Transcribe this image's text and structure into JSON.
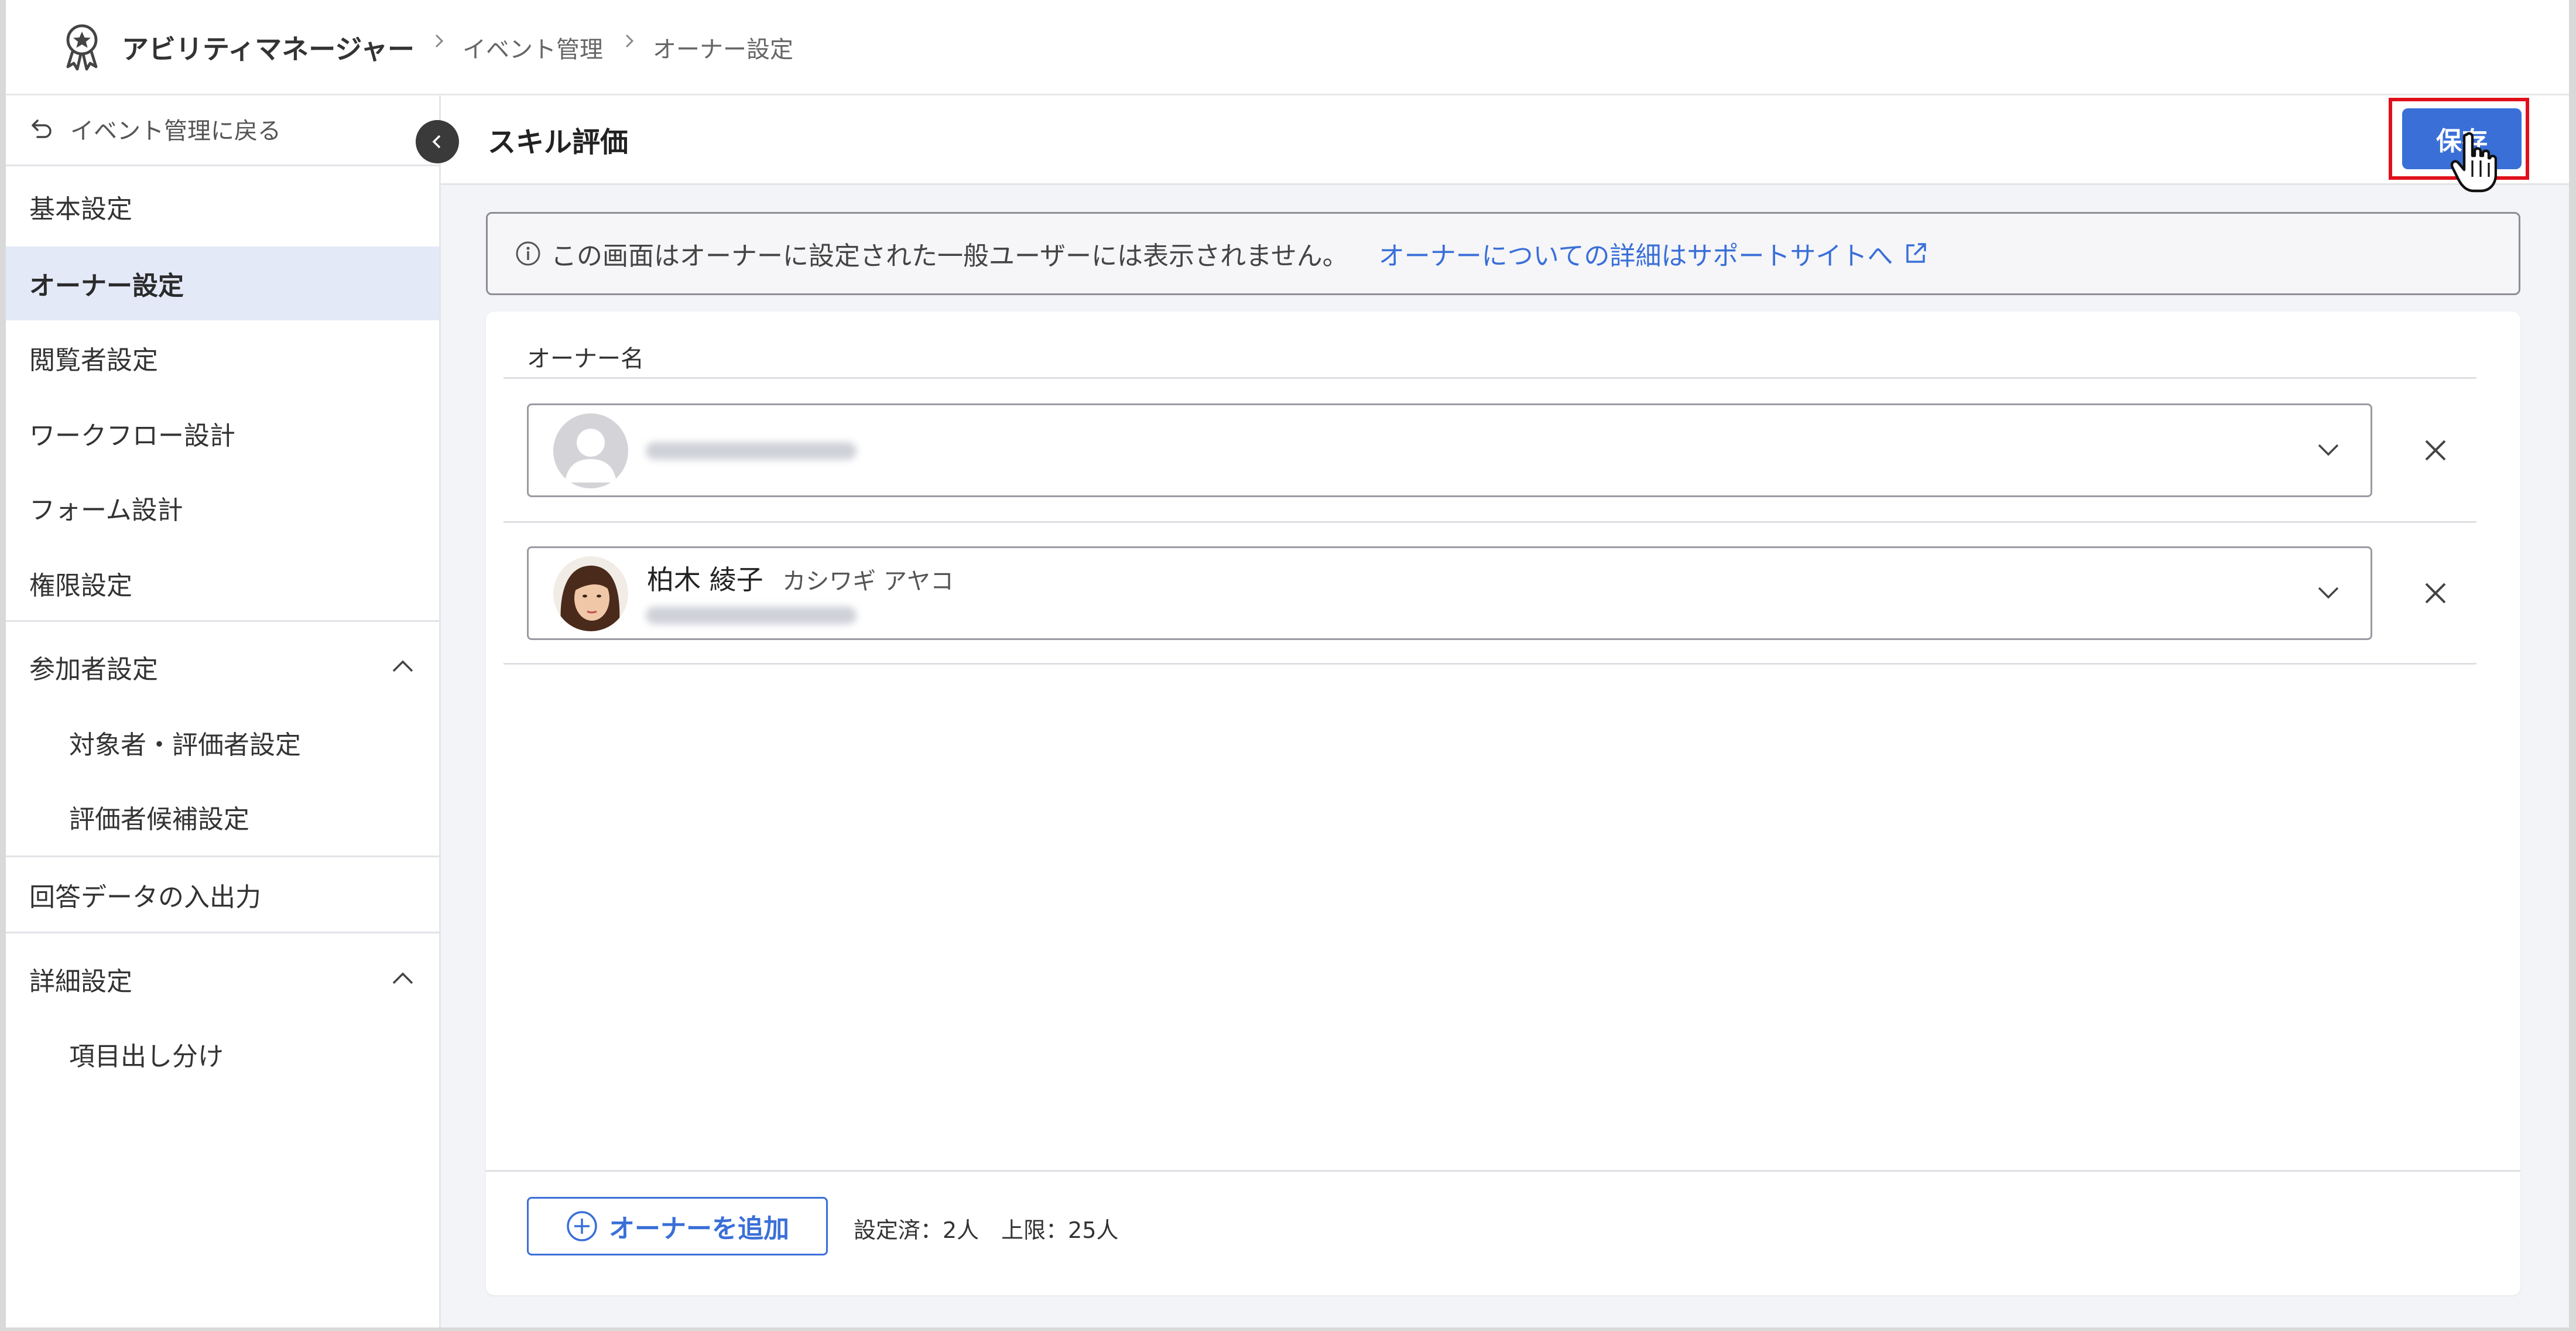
{
  "header": {
    "app_title": "アビリティマネージャー",
    "breadcrumb": [
      "イベント管理",
      "オーナー設定"
    ]
  },
  "sidebar": {
    "back_label": "イベント管理に戻る",
    "items": [
      {
        "label": "基本設定"
      },
      {
        "label": "オーナー設定",
        "active": true
      },
      {
        "label": "閲覧者設定"
      },
      {
        "label": "ワークフロー設計"
      },
      {
        "label": "フォーム設計"
      },
      {
        "label": "権限設定"
      },
      {
        "label": "参加者設定",
        "expanded": true
      },
      {
        "label": "対象者・評価者設定"
      },
      {
        "label": "評価者候補設定"
      },
      {
        "label": "回答データの入出力"
      },
      {
        "label": "詳細設定",
        "expanded": true
      },
      {
        "label": "項目出し分け"
      }
    ]
  },
  "main": {
    "title": "スキル評価",
    "save_label": "保存",
    "info_text": "この画面はオーナーに設定された一般ユーザーには表示されません。",
    "info_link": "オーナーについての詳細はサポートサイトへ",
    "owner_column_label": "オーナー名",
    "owners": [
      {
        "name": "",
        "kana": "",
        "email_blurred": true
      },
      {
        "name": "柏木 綾子",
        "kana": "カシワギ アヤコ",
        "email_blurred": true
      }
    ],
    "add_owner_label": "オーナーを追加",
    "count_text": "設定済：2人　上限：25人"
  },
  "colors": {
    "accent": "#3a6fd8",
    "active_nav_bg": "#e3e9f7",
    "highlight": "#e0101b"
  },
  "icons": [
    "award-icon",
    "chevron-right-icon",
    "undo-icon",
    "chevron-left-icon",
    "chevron-up-icon",
    "info-icon",
    "external-link-icon",
    "chevron-down-icon",
    "close-icon",
    "plus-circle-icon",
    "hand-cursor-icon"
  ]
}
